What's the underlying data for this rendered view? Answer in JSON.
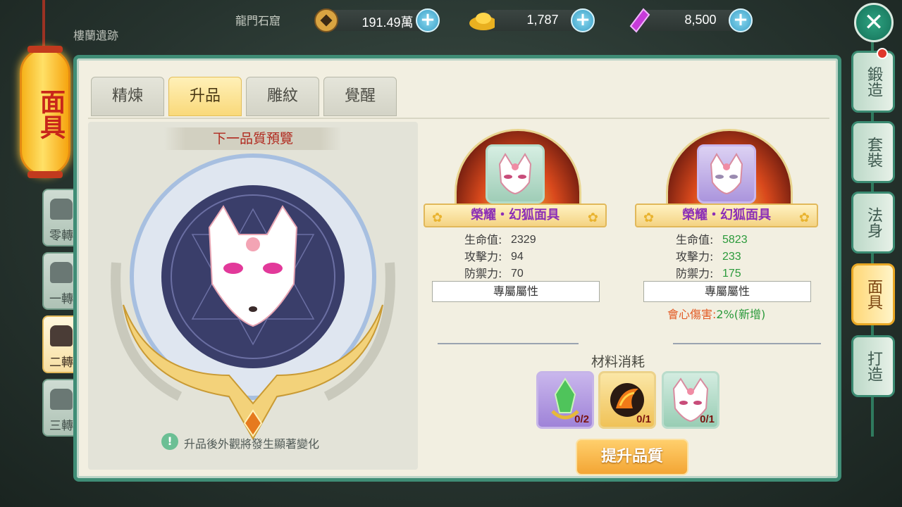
{
  "top": {
    "location_current": "龍門石窟",
    "location_prev": "樓蘭遺跡",
    "resources": [
      {
        "icon": "copper-coin-icon",
        "value": "191.49萬"
      },
      {
        "icon": "gold-ingot-icon",
        "value": "1,787"
      },
      {
        "icon": "purple-gem-icon",
        "value": "8,500"
      }
    ],
    "plus": "+"
  },
  "lantern": {
    "title": "面具"
  },
  "tiers": [
    {
      "label": "零轉"
    },
    {
      "label": "一轉"
    },
    {
      "label": "二轉"
    },
    {
      "label": "三轉"
    }
  ],
  "tabs": [
    "精煉",
    "升品",
    "雕紋",
    "覺醒"
  ],
  "preview": {
    "title": "下一品質預覽",
    "hint": "升品後外觀將發生顯著變化"
  },
  "current": {
    "name": "榮耀・幻狐面具",
    "stats": [
      {
        "k": "生命值:",
        "v": "2329"
      },
      {
        "k": "攻擊力:",
        "v": "94"
      },
      {
        "k": "防禦力:",
        "v": "70"
      }
    ],
    "attr_label": "專屬屬性"
  },
  "next": {
    "name": "榮耀・幻狐面具",
    "stats": [
      {
        "k": "生命值:",
        "v": "5823"
      },
      {
        "k": "攻擊力:",
        "v": "233"
      },
      {
        "k": "防禦力:",
        "v": "175"
      }
    ],
    "attr_label": "專屬屬性",
    "crit_label": "會心傷害:",
    "crit_value": "2%(新增)"
  },
  "materials": {
    "title": "材料消耗",
    "items": [
      {
        "icon": "green-crystal-icon",
        "count": "0/2"
      },
      {
        "icon": "flame-stone-icon",
        "count": "0/1"
      },
      {
        "icon": "fox-mask-icon",
        "count": "0/1"
      }
    ]
  },
  "upgrade_button": "提升品質",
  "side_tabs": [
    "鍛造",
    "套裝",
    "法身",
    "面具",
    "打造"
  ],
  "colors": {
    "accent": "#3f8d76",
    "active_tab": "#f9d97a",
    "stat_up": "#2b9a3b",
    "crit": "#e35b25"
  }
}
